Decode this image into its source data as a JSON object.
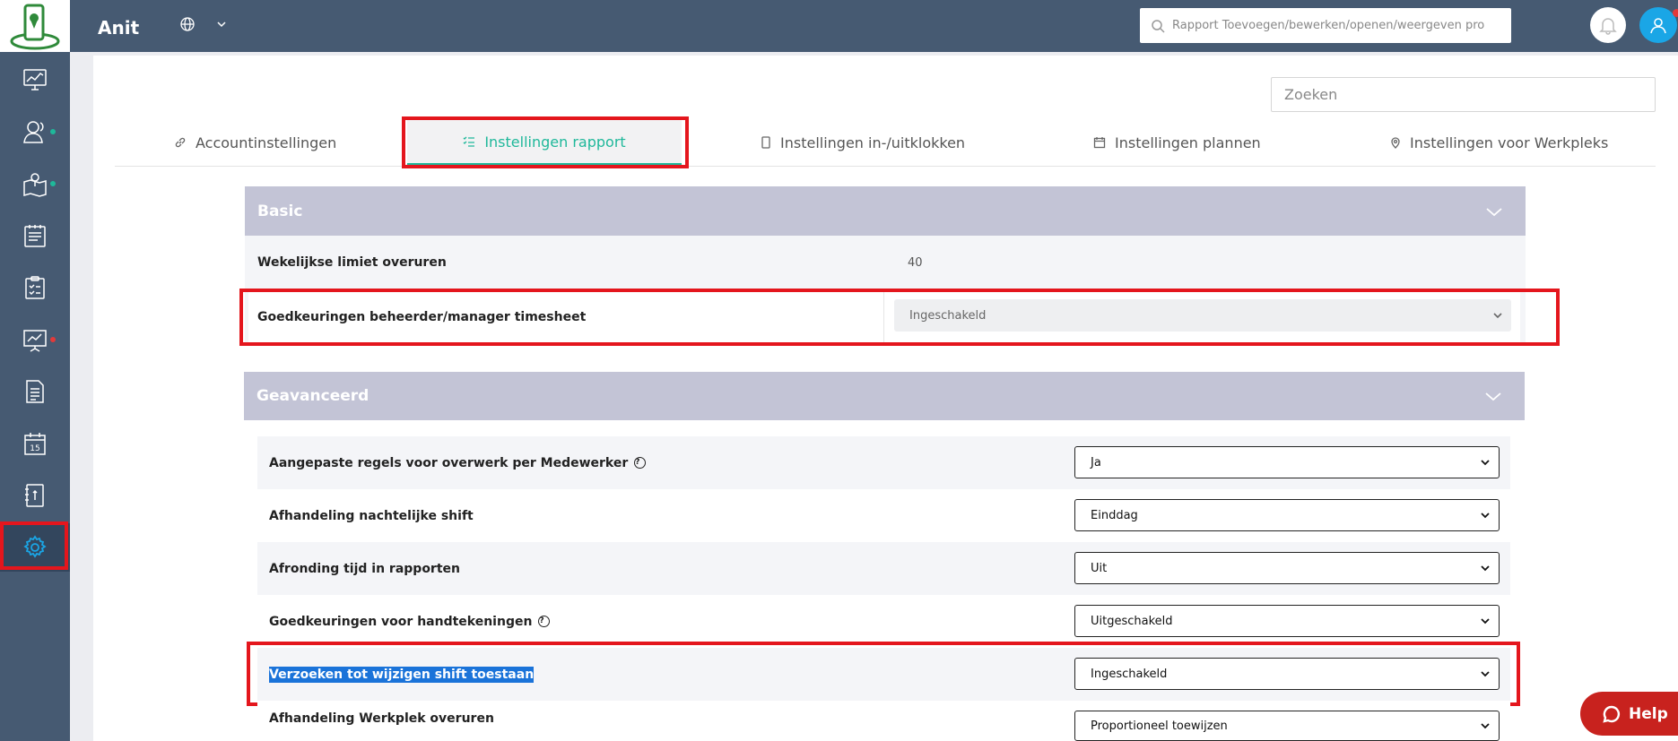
{
  "header": {
    "app_title": "Anit",
    "search_placeholder": "Rapport Toevoegen/bewerken/openen/weergeven pro"
  },
  "sidebar": {
    "items": [
      {
        "icon": "monitor-chart-icon"
      },
      {
        "icon": "users-icon",
        "dot": "#1fb89a"
      },
      {
        "icon": "map-pin-icon",
        "dot": "#1fb89a"
      },
      {
        "icon": "clipboard-list-icon"
      },
      {
        "icon": "checklist-icon"
      },
      {
        "icon": "presentation-chart-icon",
        "dot": "#e23a3a"
      },
      {
        "icon": "document-icon"
      },
      {
        "icon": "calendar-icon",
        "text": "15"
      },
      {
        "icon": "notebook-icon"
      },
      {
        "icon": "gear-icon",
        "active": true
      }
    ]
  },
  "page": {
    "search_placeholder": "Zoeken"
  },
  "tabs": [
    {
      "label": "Accountinstellingen"
    },
    {
      "label": "Instellingen rapport",
      "active": true
    },
    {
      "label": "Instellingen in-/uitklokken"
    },
    {
      "label": "Instellingen plannen"
    },
    {
      "label": "Instellingen voor Werkpleks"
    }
  ],
  "basic": {
    "title": "Basic",
    "rows": [
      {
        "label": "Wekelijkse limiet overuren",
        "value": "40"
      },
      {
        "label": "Goedkeuringen beheerder/manager timesheet",
        "value": "Ingeschakeld"
      }
    ]
  },
  "advanced": {
    "title": "Geavanceerd",
    "rows": [
      {
        "label": "Aangepaste regels voor overwerk per Medewerker",
        "value": "Ja",
        "help": "?"
      },
      {
        "label": "Afhandeling nachtelijke shift",
        "value": "Einddag"
      },
      {
        "label": "Afronding tijd in rapporten",
        "value": "Uit"
      },
      {
        "label": "Goedkeuringen voor handtekeningen",
        "value": "Uitgeschakeld",
        "help": "?"
      },
      {
        "label": "Verzoeken tot wijzigen shift toestaan",
        "value": "Ingeschakeld"
      },
      {
        "label": "Afhandeling Werkplek overuren",
        "value": "Proportioneel toewijzen"
      }
    ]
  },
  "help_button": {
    "label": "Help"
  },
  "colors": {
    "sidebar_bg": "#465a72",
    "accent": "#1fb89a",
    "highlight": "#e4161d",
    "section_header": "#c3c4d6",
    "help_bg": "#c8221e"
  }
}
